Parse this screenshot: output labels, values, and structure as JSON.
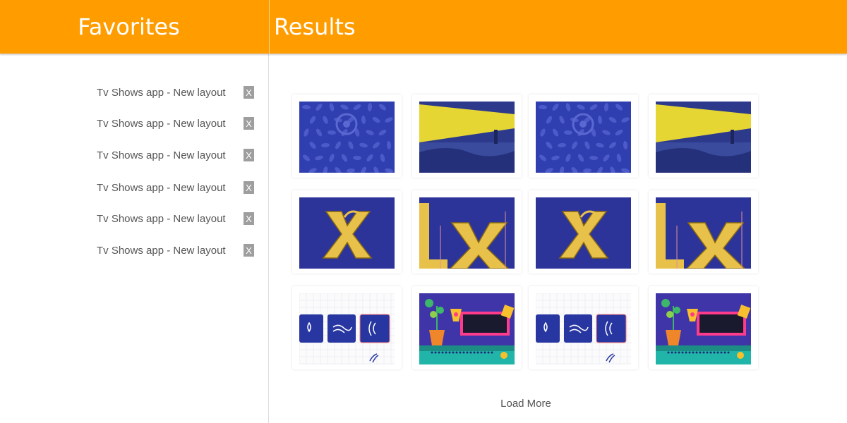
{
  "header": {
    "left_title": "Favorites",
    "right_title": "Results"
  },
  "favorites": [
    {
      "label": "Tv Shows app - New layout",
      "remove": "X"
    },
    {
      "label": "Tv Shows app - New layout",
      "remove": "X"
    },
    {
      "label": "Tv Shows app - New layout",
      "remove": "X"
    },
    {
      "label": "Tv Shows app - New layout",
      "remove": "X"
    },
    {
      "label": "Tv Shows app - New layout",
      "remove": "X"
    },
    {
      "label": "Tv Shows app - New layout",
      "remove": "X"
    }
  ],
  "results": {
    "thumbnails": [
      [
        "blue-pattern",
        "lighthouse",
        "blue-pattern",
        "lighthouse"
      ],
      [
        "letter-x",
        "letter-lx",
        "letter-x",
        "letter-lx"
      ],
      [
        "water-icons",
        "flower-illustration",
        "water-icons",
        "flower-illustration"
      ]
    ],
    "load_more": "Load More"
  },
  "colors": {
    "accent": "#ff9c00",
    "thumb_blue": "#2d3499",
    "gold": "#e8c14a"
  }
}
